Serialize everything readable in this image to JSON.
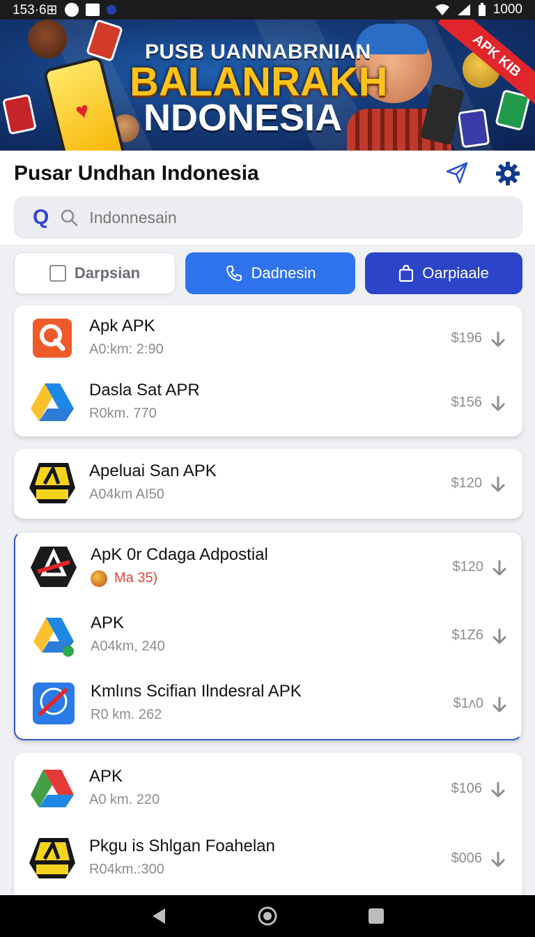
{
  "status_bar": {
    "time": "153·6⊞",
    "battery": "1000"
  },
  "banner": {
    "line1": "PUSB UANNABRNIAN",
    "line2": "BALANRAKH",
    "line3": "NDONESIA",
    "ribbon": "APK KIB"
  },
  "appbar": {
    "title": "Pusar Undhan Indonesia"
  },
  "search": {
    "placeholder": "Indonnesain"
  },
  "chips": [
    {
      "label": "Darpsian"
    },
    {
      "label": "Dadnesin"
    },
    {
      "label": "Oarpiaale"
    }
  ],
  "cards": [
    {
      "rows": [
        {
          "name": "Apk APK",
          "meta": "A0:km: 2:90",
          "price": "$196"
        },
        {
          "name": "Dasla Sat APR",
          "meta": "R0km. 770",
          "price": "$156"
        }
      ]
    },
    {
      "rows": [
        {
          "name": "Apeluai San APK",
          "meta": "A04km AI50",
          "price": "$120"
        }
      ]
    },
    {
      "rows": [
        {
          "name": "ApK 0r Cdaga Adpostial",
          "meta": "Ma 35)",
          "price": "$120"
        },
        {
          "name": "APK",
          "meta": "A04km, 240",
          "price": "$1Z6"
        },
        {
          "name": "Kmlıns Scifian Ilndesral APK",
          "meta": "R0 km. 262",
          "price": "$1ᴧ0"
        }
      ]
    },
    {
      "rows": [
        {
          "name": "APK",
          "meta": "A0 km. 220",
          "price": "$106"
        },
        {
          "name": "Pkgu is Shlgan Foahelan",
          "meta": "R04km.:300",
          "price": "$006"
        }
      ]
    }
  ],
  "icons": {
    "accent": "#2f73ec",
    "accent_dark": "#2b44c9",
    "brand_send": "#2e55cc"
  }
}
